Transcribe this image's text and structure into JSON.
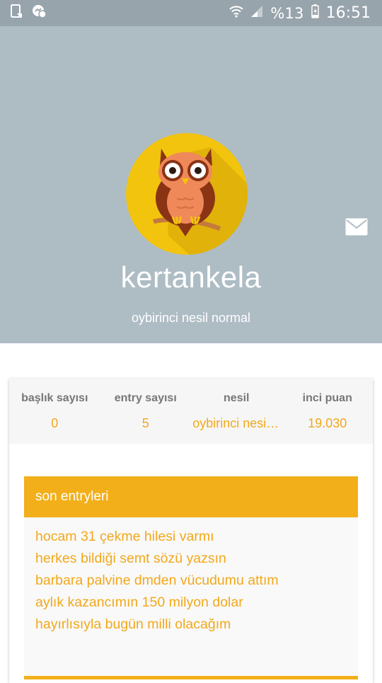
{
  "status_bar": {
    "battery_percent": "%13",
    "time": "16:51",
    "icons": [
      "screenshot-icon",
      "messenger-icon",
      "wifi-icon",
      "signal-icon",
      "battery-charging-icon"
    ]
  },
  "profile": {
    "username": "kertankela",
    "subtitle": "oybirinci nesil normal",
    "avatar": "owl-avatar",
    "message_icon": "mail-icon"
  },
  "stats": [
    {
      "label": "başlık sayısı",
      "value": "0"
    },
    {
      "label": "entry sayısı",
      "value": "5"
    },
    {
      "label": "nesil",
      "value": "oybirinci nesil normal"
    },
    {
      "label": "inci puan",
      "value": "19.030"
    }
  ],
  "recent_entries": {
    "title": "son entryleri",
    "items": [
      "hocam 31 çekme hilesi varmı",
      "herkes bildiği semt sözü yazsın",
      "barbara palvine dmden vücudumu attım",
      "aylık kazancımın 150 milyon dolar",
      "hayırlısıyla bugün milli olacağım"
    ]
  },
  "colors": {
    "accent": "#f3af1a",
    "header_bg": "#aebcc4",
    "avatar_bg": "#f2c40d"
  }
}
